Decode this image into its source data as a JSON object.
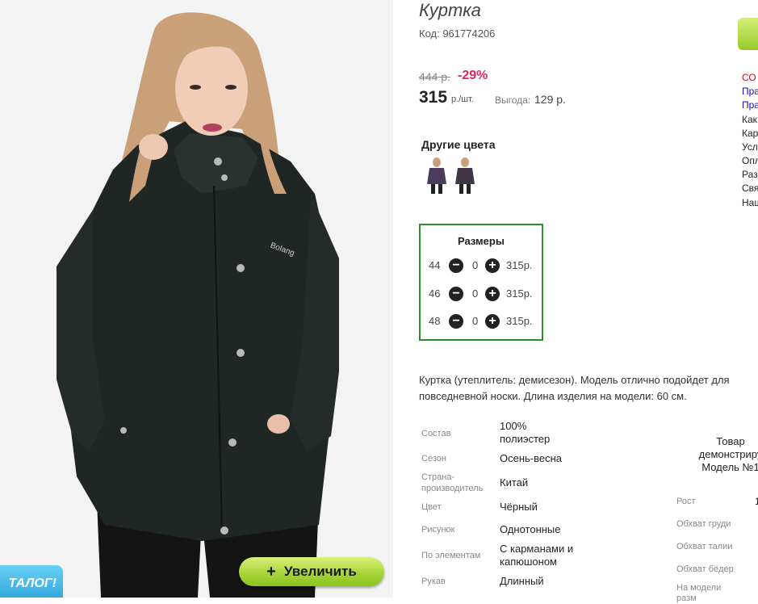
{
  "product": {
    "title": "Куртка",
    "code": "Код: 961774206",
    "old_price": "444 р.",
    "discount": "-29%",
    "price": "315",
    "unit": "р./шт.",
    "save_label": "Выгода:",
    "save_value": "129 р."
  },
  "photo": {
    "zoom_label": "Увеличить",
    "zoom_plus": "+",
    "catalog_tab": "ТАЛОГ!"
  },
  "colors": {
    "heading": "Другие цвета",
    "swatches": [
      {
        "color": "#4a3d5c",
        "icon": "purple-jacket-thumb"
      },
      {
        "color": "#3e3647",
        "icon": "dark-jacket-thumb"
      }
    ]
  },
  "sizes": {
    "heading": "Размеры",
    "rows": [
      {
        "size": "44",
        "qty": "0",
        "price": "315р."
      },
      {
        "size": "46",
        "qty": "0",
        "price": "315р."
      },
      {
        "size": "48",
        "qty": "0",
        "price": "315р."
      }
    ]
  },
  "description": {
    "line1": "Куртка (утеплитель: демисезон). Модель отлично подойдет для",
    "line2": "повседневной носки. Длина изделия на модели: 60 см."
  },
  "attributes": [
    {
      "label": "Состав",
      "value": "100%\nполиэстер"
    },
    {
      "label": "Сезон",
      "value": "Осень-весна"
    },
    {
      "label": "Страна-\nпроизводитель",
      "value": "Китай"
    },
    {
      "label": "Цвет",
      "value": "Чёрный"
    },
    {
      "label": "Рисунок",
      "value": "Однотонные"
    },
    {
      "label": "По элементам",
      "value": "С карманами и\nкапюшоном"
    },
    {
      "label": "Рукав",
      "value": "Длинный"
    }
  ],
  "model": {
    "heading": "Товар\nдемонстриру\nМодель №1",
    "measurements": [
      {
        "label": "Рост",
        "value": "1"
      },
      {
        "label": "Обхват груди"
      },
      {
        "label": "Обхват талии"
      },
      {
        "label": "Обхват бёдер"
      },
      {
        "label": "На модели\nразм"
      }
    ]
  },
  "side_links": [
    "СО",
    "Пра",
    "Пра",
    "Как",
    "Кар",
    "Усл",
    "Опл",
    "Раз",
    "Свя",
    "Наш"
  ],
  "colors_theme": {
    "discount": "#e0245a",
    "accent_green": "#8cc21d",
    "border_green": "#2e8b2e",
    "link_blue": "#1a0dab",
    "sale_red": "#d0021b"
  }
}
